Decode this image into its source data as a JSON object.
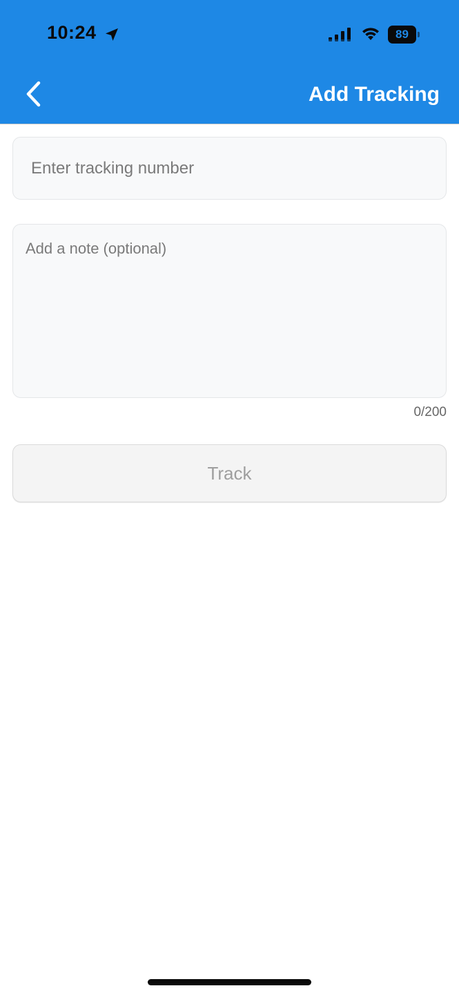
{
  "status_bar": {
    "time": "10:24",
    "battery_level": "89",
    "icons": [
      "location-arrow-icon",
      "cellular-signal-icon",
      "wifi-icon",
      "battery-icon"
    ]
  },
  "nav_bar": {
    "back_icon": "chevron-left-icon",
    "title": "Add Tracking"
  },
  "form": {
    "tracking_number": {
      "value": "",
      "placeholder": "Enter tracking number"
    },
    "note": {
      "value": "",
      "placeholder": "Add a note (optional)"
    },
    "char_counter": "0/200",
    "track_button_label": "Track"
  },
  "colors": {
    "header_bg": "#1e88e5",
    "title_text": "#ffffff",
    "input_bg": "#f8f9fa",
    "button_disabled_text": "#9e9e9e"
  }
}
